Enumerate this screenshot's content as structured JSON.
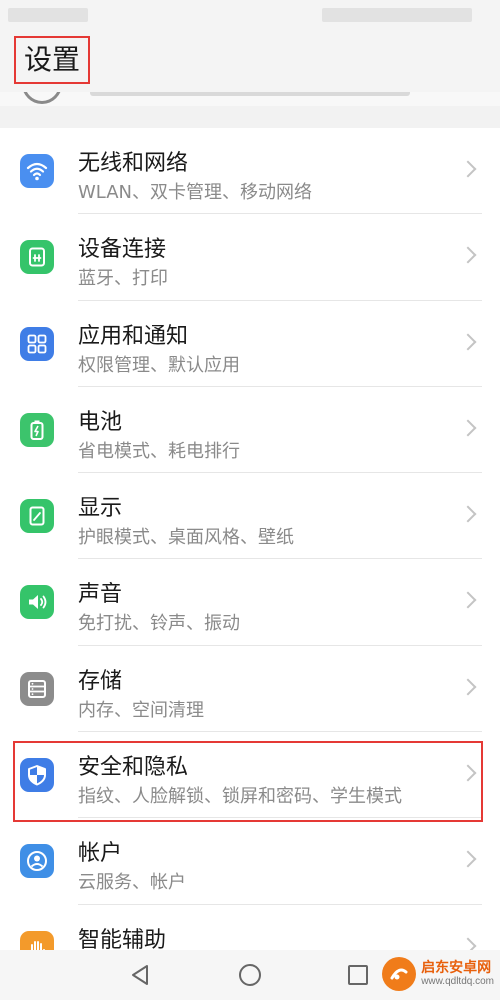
{
  "header": {
    "title": "设置"
  },
  "settings": {
    "items": [
      {
        "title": "无线和网络",
        "subtitle": "WLAN、双卡管理、移动网络",
        "icon": "wifi-icon",
        "color": "#4a8ff0"
      },
      {
        "title": "设备连接",
        "subtitle": "蓝牙、打印",
        "icon": "device-connect-icon",
        "color": "#35c46a"
      },
      {
        "title": "应用和通知",
        "subtitle": "权限管理、默认应用",
        "icon": "apps-grid-icon",
        "color": "#3f7de6"
      },
      {
        "title": "电池",
        "subtitle": "省电模式、耗电排行",
        "icon": "battery-icon",
        "color": "#3cc46c"
      },
      {
        "title": "显示",
        "subtitle": "护眼模式、桌面风格、壁纸",
        "icon": "display-icon",
        "color": "#35c46a"
      },
      {
        "title": "声音",
        "subtitle": "免打扰、铃声、振动",
        "icon": "sound-icon",
        "color": "#35c46a"
      },
      {
        "title": "存储",
        "subtitle": "内存、空间清理",
        "icon": "storage-icon",
        "color": "#8c8c8c"
      },
      {
        "title": "安全和隐私",
        "subtitle": "指纹、人脸解锁、锁屏和密码、学生模式",
        "icon": "shield-icon",
        "color": "#3f7de6",
        "highlighted": true
      },
      {
        "title": "帐户",
        "subtitle": "云服务、帐户",
        "icon": "account-icon",
        "color": "#3f8fe6"
      },
      {
        "title": "智能辅助",
        "subtitle": "",
        "icon": "hand-icon",
        "color": "#f39a2b"
      }
    ]
  },
  "nav": {
    "back_icon": "back-triangle-icon",
    "home_icon": "home-circle-icon",
    "recents_icon": "recents-square-icon"
  },
  "watermark": {
    "name": "启东安卓网",
    "url": "www.qdltdq.com",
    "accent": "#f07c1a"
  }
}
